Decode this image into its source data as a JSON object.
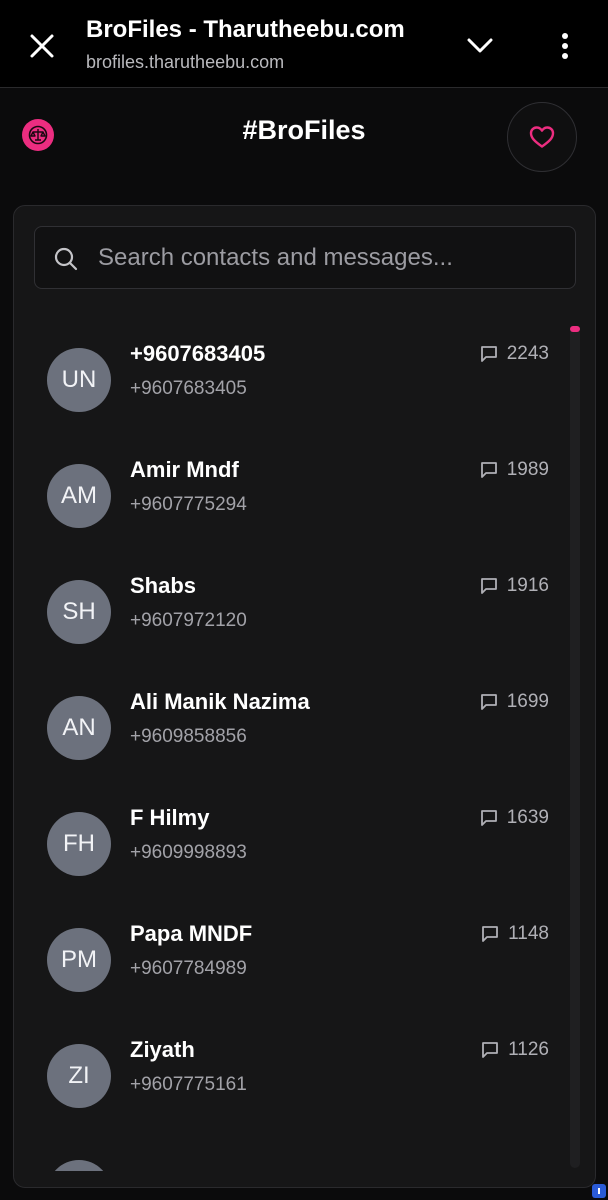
{
  "browser": {
    "title": "BroFiles - Tharutheebu.com",
    "url": "brofiles.tharutheebu.com"
  },
  "app": {
    "title": "#BroFiles",
    "accent": "#ec2d80"
  },
  "search": {
    "placeholder": "Search contacts and messages..."
  },
  "contacts": [
    {
      "initials": "UN",
      "name": "+9607683405",
      "phone": "+9607683405",
      "count": "2243"
    },
    {
      "initials": "AM",
      "name": "Amir Mndf",
      "phone": "+9607775294",
      "count": "1989"
    },
    {
      "initials": "SH",
      "name": "Shabs",
      "phone": "+9607972120",
      "count": "1916"
    },
    {
      "initials": "AN",
      "name": "Ali Manik Nazima",
      "phone": "+9609858856",
      "count": "1699"
    },
    {
      "initials": "FH",
      "name": "F Hilmy",
      "phone": "+9609998893",
      "count": "1639"
    },
    {
      "initials": "PM",
      "name": "Papa MNDF",
      "phone": "+9607784989",
      "count": "1148"
    },
    {
      "initials": "ZI",
      "name": "Ziyath",
      "phone": "+9607775161",
      "count": "1126"
    }
  ]
}
